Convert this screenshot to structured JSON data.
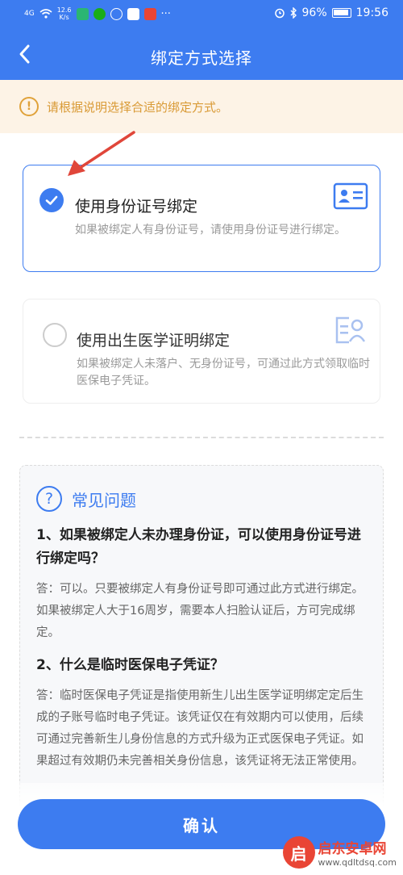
{
  "status_bar": {
    "signal": "4G",
    "speed_top": "12.6",
    "speed_bottom": "K/s",
    "battery_text": "96%",
    "time": "19:56",
    "more": "···"
  },
  "header": {
    "title": "绑定方式选择"
  },
  "notice": {
    "icon": "!",
    "text": "请根据说明选择合适的绑定方式。"
  },
  "options": [
    {
      "title": "使用身份证号绑定",
      "desc": "如果被绑定人有身份证号，请使用身份证号进行绑定。",
      "selected": true,
      "icon": "id-card-icon"
    },
    {
      "title": "使用出生医学证明绑定",
      "desc": "如果被绑定人未落户、无身份证号，可通过此方式领取临时医保电子凭证。",
      "selected": false,
      "icon": "birth-certificate-icon"
    }
  ],
  "faq": {
    "icon": "?",
    "title": "常见问题",
    "items": [
      {
        "q": "1、如果被绑定人未办理身份证，可以使用身份证号进行绑定吗？",
        "a": "答：可以。只要被绑定人有身份证号即可通过此方式进行绑定。如果被绑定人大于16周岁，需要本人扫脸认证后，方可完成绑定。"
      },
      {
        "q": "2、什么是临时医保电子凭证？",
        "a": "答：临时医保电子凭证是指使用新生儿出生医学证明绑定定后生成的子账号临时电子凭证。该凭证仅在有效期内可以使用，后续可通过完善新生儿身份信息的方式升级为正式医保电子凭证。如果超过有效期仍未完善相关身份信息，该凭证将无法正常使用。"
      }
    ]
  },
  "confirm_label": "确认",
  "watermark": {
    "logo": "启",
    "name": "启东安卓网",
    "url": "www.qdltdsq.com"
  },
  "colors": {
    "primary": "#3d7cf0",
    "notice_bg": "#fdf3e6",
    "notice_text": "#d99a35",
    "arrow": "#e0463a"
  }
}
